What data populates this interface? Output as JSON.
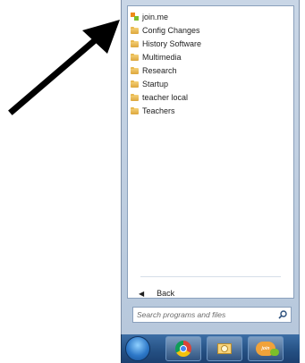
{
  "start_menu": {
    "programs": [
      {
        "label": "join.me",
        "icon": "joinme-icon"
      },
      {
        "label": "Config Changes",
        "icon": "folder-icon"
      },
      {
        "label": "History Software",
        "icon": "folder-icon"
      },
      {
        "label": "Multimedia",
        "icon": "folder-icon"
      },
      {
        "label": "Research",
        "icon": "folder-icon"
      },
      {
        "label": "Startup",
        "icon": "folder-icon"
      },
      {
        "label": "teacher local",
        "icon": "folder-icon"
      },
      {
        "label": "Teachers",
        "icon": "folder-icon"
      }
    ],
    "back_label": "Back",
    "search_placeholder": "Search programs and files"
  },
  "taskbar": {
    "items": [
      "start-orb",
      "chrome-icon",
      "outlook-icon",
      "joinme-icon"
    ]
  },
  "colors": {
    "accent": "#2d78c8",
    "arrow": "#000000"
  }
}
